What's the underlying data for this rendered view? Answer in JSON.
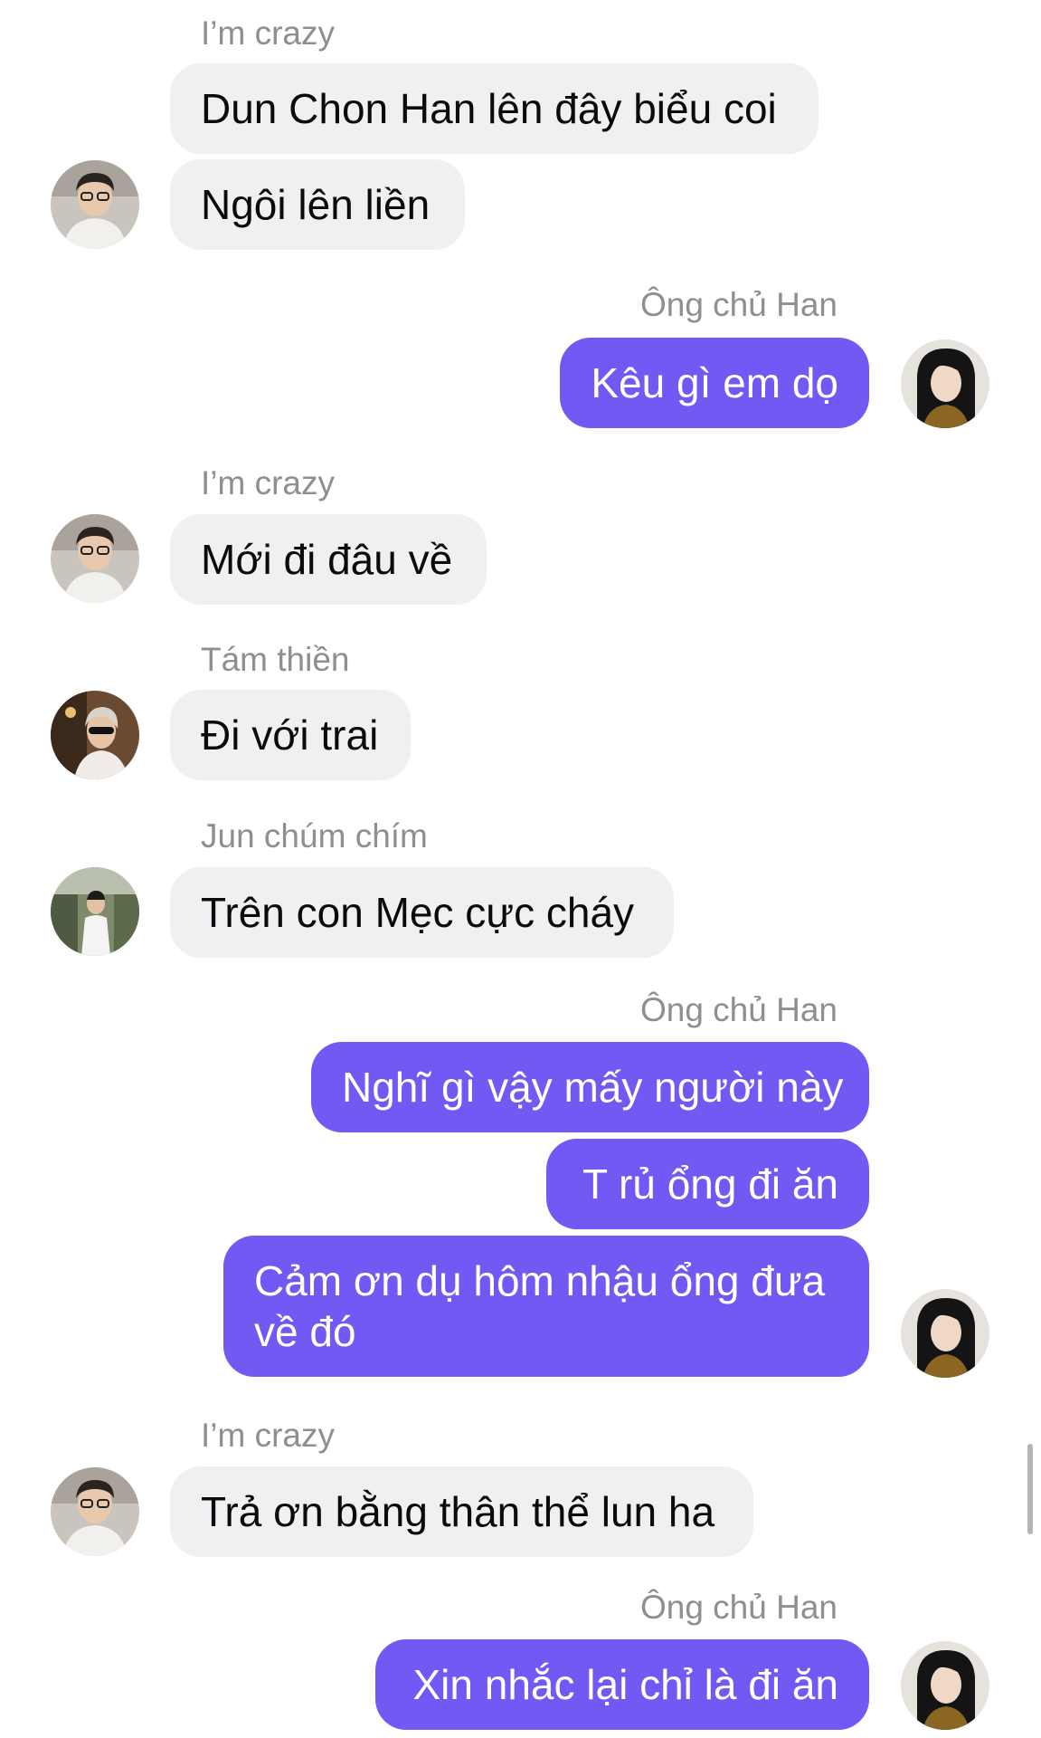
{
  "messages": [
    {
      "sender": "I’m crazy",
      "texts": [
        "Dun Chon Han lên đây biểu coi",
        "Ngôi lên liền"
      ]
    },
    {
      "sender": "Ông chủ Han",
      "texts": [
        "Kêu gì em dọ"
      ]
    },
    {
      "sender": "I’m crazy",
      "texts": [
        "Mới đi đâu về"
      ]
    },
    {
      "sender": "Tám thiền",
      "texts": [
        "Đi với trai"
      ]
    },
    {
      "sender": "Jun chúm chím",
      "texts": [
        "Trên con Mẹc cực cháy"
      ]
    },
    {
      "sender": "Ông chủ Han",
      "texts": [
        "Nghĩ gì vậy mấy người này",
        "T rủ ổng đi ăn",
        "Cảm ơn dụ hôm nhậu ổng đưa về đó"
      ]
    },
    {
      "sender": "I’m crazy",
      "texts": [
        "Trả ơn bằng thân thể lun ha"
      ]
    },
    {
      "sender": "Ông chủ Han",
      "texts": [
        "Xin nhắc lại chỉ là đi ăn"
      ]
    }
  ],
  "colors": {
    "outgoing_bubble": "#7259f3",
    "incoming_bubble": "#f0f0f3",
    "sender_label": "#8e8e93"
  },
  "icons": {
    "avatar_crazy": "avatar-photo-glasses-man",
    "avatar_han": "avatar-photo-long-hair",
    "avatar_tam": "avatar-photo-sunglasses",
    "avatar_jun": "avatar-photo-outdoor"
  }
}
